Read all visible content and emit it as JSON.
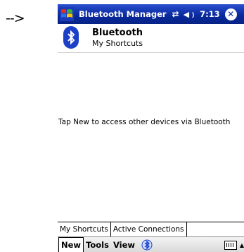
{
  "annotation_arrow": "-->",
  "titlebar": {
    "title": "Bluetooth Manager",
    "time": "7:13"
  },
  "header": {
    "title": "Bluetooth",
    "subtitle": "My Shortcuts"
  },
  "content": {
    "hint": "Tap New to access other devices via Bluetooth"
  },
  "tabs": [
    {
      "label": "My Shortcuts",
      "active": true
    },
    {
      "label": "Active Connections",
      "active": false
    }
  ],
  "menubar": {
    "new_label": "New",
    "tools_label": "Tools",
    "view_label": "View"
  },
  "colors": {
    "titlebar": "#0a2a9e",
    "bluetooth_badge": "#1d40c9"
  }
}
